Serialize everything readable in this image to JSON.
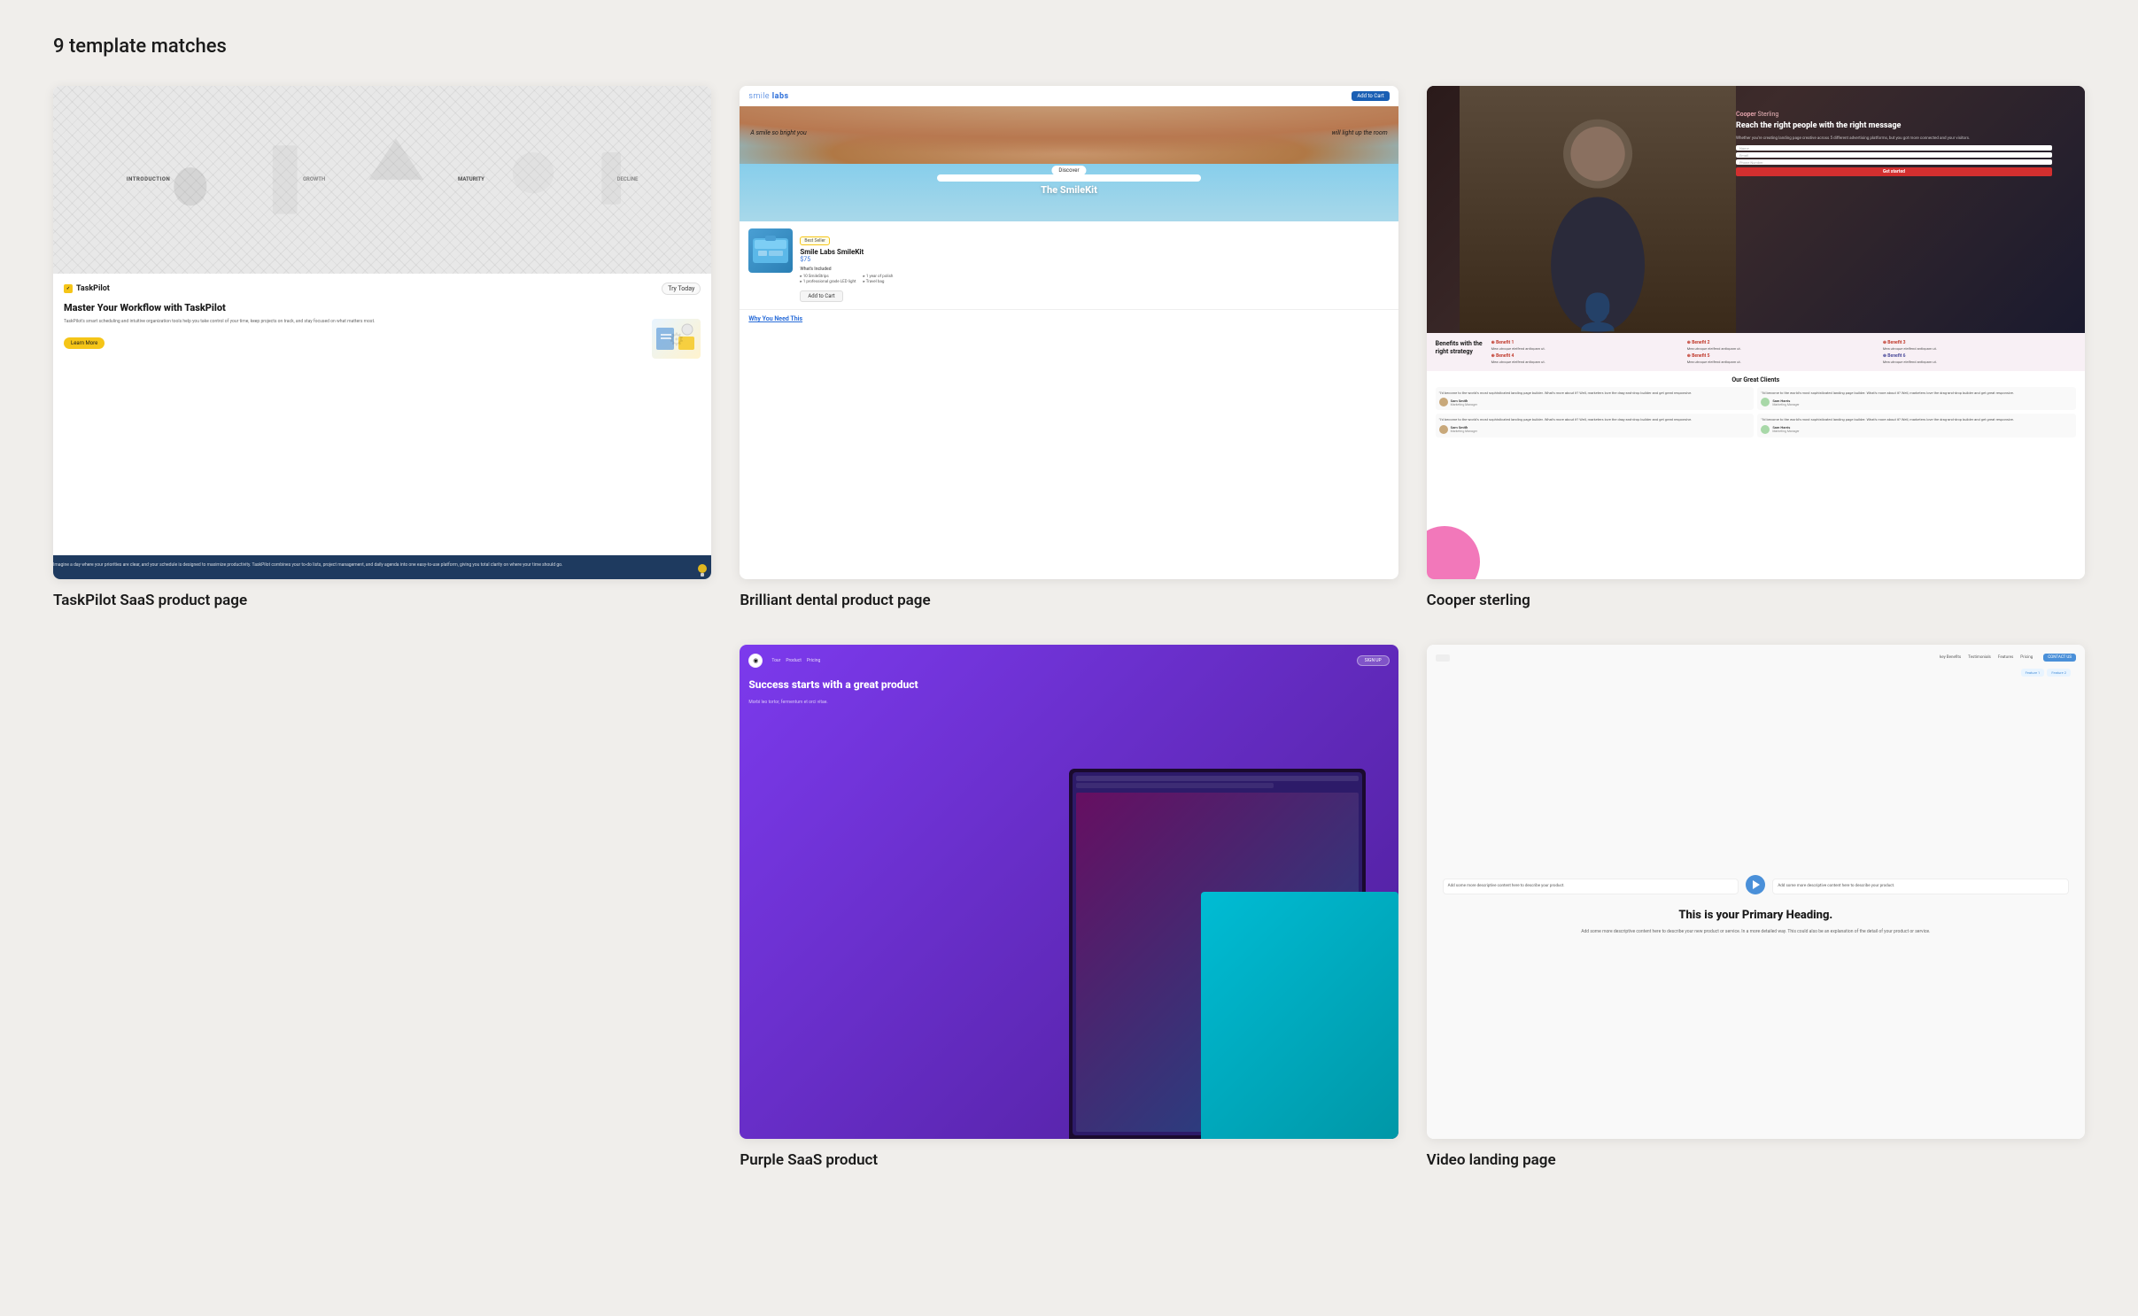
{
  "page": {
    "title": "9 template matches"
  },
  "templates": [
    {
      "id": "taskpilot",
      "label": "TaskPilot SaaS product page",
      "thumb_type": "taskpilot",
      "hero_labels": [
        "INTRODUCTION",
        "GROWTH",
        "MATURITY",
        "DECLINE"
      ],
      "logo": "TaskPilot",
      "try_btn": "Try Today",
      "headline": "Master Your Workflow with TaskPilot",
      "description": "TaskPilot's smart scheduling and intuitive organization tools help you take control of your time, keep projects on track, and stay focused on what matters most.",
      "cta": "Learn More",
      "footer_text": "Imagine a day where your priorities are clear, and your schedule is designed to maximize productivity. TaskPilot combines your to-do lists, project management, and daily agenda into one easy-to-use platform, giving you total clarity on where your time should go."
    },
    {
      "id": "smile",
      "label": "Brilliant dental product page",
      "thumb_type": "smile",
      "logo": "smile labs",
      "cart_btn": "Add to Cart",
      "tagline_left": "A smile so bright you",
      "tagline_right": "will light up the room",
      "discover_btn": "Discover",
      "kit_name": "The SmileKit",
      "best_seller": "Best Seller",
      "product_name": "Smile Labs SmileKit",
      "product_price": "$75",
      "included_title": "What's Included",
      "items_col1": [
        "10 SmileStrips",
        "1 professional grade LED light"
      ],
      "items_col2": [
        "1 year of polish",
        "Travel bag"
      ],
      "add_btn": "Add to Cart",
      "why_title": "Why You Need This"
    },
    {
      "id": "cooper",
      "label": "Cooper sterling",
      "thumb_type": "cooper",
      "brand": "Cooper Sterling",
      "headline": "Reach the right people with the right message",
      "form_fields": [
        "Name",
        "Email",
        "Phone Number"
      ],
      "submit_btn": "Get started",
      "benefits_title": "Benefits with the right strategy",
      "benefits": [
        {
          "title": "Benefit 1",
          "text": "Et has lorem vitae molestiae. Mea utroque eleifend antiopam ut."
        },
        {
          "title": "Benefit 2",
          "text": "Et has lorem vitae molestiae. Mea utroque eleifend antiopam ut."
        },
        {
          "title": "Benefit 3",
          "text": "Et has lorem vitae molestiae. Mea utroque eleifend antiopam ut."
        },
        {
          "title": "Benefit 4",
          "text": "Et has lorem vitae molestiae. Mea utroque eleifend antiopam ut."
        },
        {
          "title": "Benefit 5",
          "text": "Et has lorem vitae molestiae. Mea utroque eleifend antiopam ut."
        },
        {
          "title": "Benefit 6",
          "text": "Et has lorem vitae molestiae. Mea utroque eleifend antiopam ut."
        }
      ],
      "clients_title": "Our Great Clients",
      "reviews": [
        {
          "text": "I'd become to the world's most sophisticated landing page builder. What I love about it? Well, marketers love the drag-and-drop builder and get great responsive.",
          "author": "Sam Smith",
          "role": "Marketing Manager"
        },
        {
          "text": "I'd become to the world's most sophisticated landing page builder. What I love about it? Well, marketers love the drag-and-drop builder and get great responsive.",
          "author": "Sam Harris",
          "role": "Marketing Manager"
        },
        {
          "text": "I'd become to the world's most sophisticated landing page builder. What I love about it? Well, marketers love the drag-and-drop builder and get great responsive.",
          "author": "Sam Smith",
          "role": "Marketing Manager"
        },
        {
          "text": "I'd become to the world's most sophisticated landing page builder. What I love about it? Well, marketers love the drag-and-drop builder and get great responsive.",
          "author": "Sam Harris",
          "role": "Marketing Manager"
        }
      ]
    },
    {
      "id": "purple-saas",
      "label": "Purple SaaS product",
      "thumb_type": "purple",
      "nav_links": [
        "Tour",
        "Product",
        "Pricing"
      ],
      "signup_btn": "SIGN UP",
      "headline": "Success starts with a great product",
      "body_text": "Morbi leo tortor, fermentum et orci vitae."
    },
    {
      "id": "video-landing",
      "label": "Video landing page",
      "thumb_type": "video",
      "nav_links": [
        "key Benefits",
        "Testimonials",
        "Features",
        "Pricing"
      ],
      "headline": "This is your Primary Heading.",
      "description": "Add some more descriptive content here to describe your new product or service. In a more detailed way. This could also be an explanation of the detail of your product or service."
    }
  ]
}
